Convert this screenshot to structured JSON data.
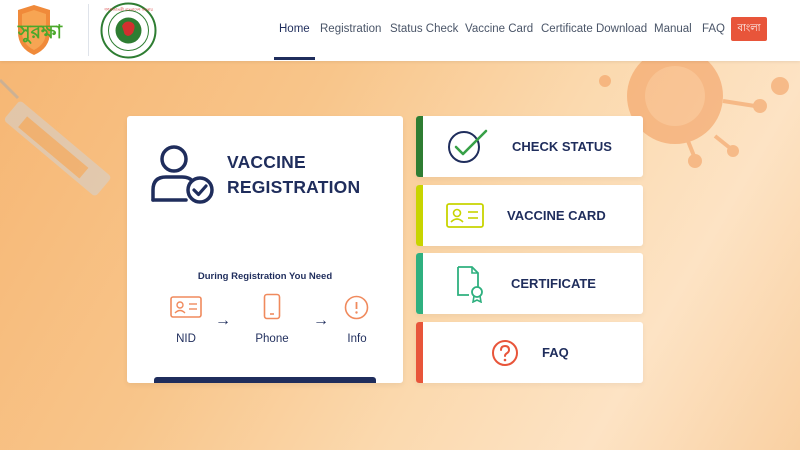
{
  "header": {
    "logo_text": "সুরক্ষা",
    "gov_logo_text": "গণপ্রজাতন্ত্রী বাংলাদেশ সরকার",
    "nav": [
      {
        "label": "Home",
        "active": true
      },
      {
        "label": "Registration",
        "active": false
      },
      {
        "label": "Status Check",
        "active": false
      },
      {
        "label": "Vaccine Card",
        "active": false
      },
      {
        "label": "Certificate Download",
        "active": false
      },
      {
        "label": "Manual",
        "active": false
      },
      {
        "label": "FAQ",
        "active": false
      }
    ],
    "lang_button": "বাংলা"
  },
  "registration": {
    "title_line1": "VACCINE",
    "title_line2": "REGISTRATION",
    "need_title": "During Registration You Need",
    "needs": [
      {
        "label": "NID",
        "icon": "id-card-icon"
      },
      {
        "label": "Phone",
        "icon": "phone-icon"
      },
      {
        "label": "Info",
        "icon": "info-icon"
      }
    ]
  },
  "side_cards": [
    {
      "label": "CHECK STATUS",
      "icon": "check-circle-icon",
      "accent": "#2e7d32"
    },
    {
      "label": "VACCINE CARD",
      "icon": "id-card-icon",
      "accent": "#c8d400"
    },
    {
      "label": "CERTIFICATE",
      "icon": "certificate-icon",
      "accent": "#2fb07f"
    },
    {
      "label": "FAQ",
      "icon": "question-icon",
      "accent": "#e8553a"
    }
  ],
  "colors": {
    "navy": "#1f2d5c",
    "brand_orange": "#e8553a",
    "green": "#37a047",
    "yellow": "#c8d400",
    "teal": "#2fb07f",
    "bg_orange": "#f6b572"
  }
}
